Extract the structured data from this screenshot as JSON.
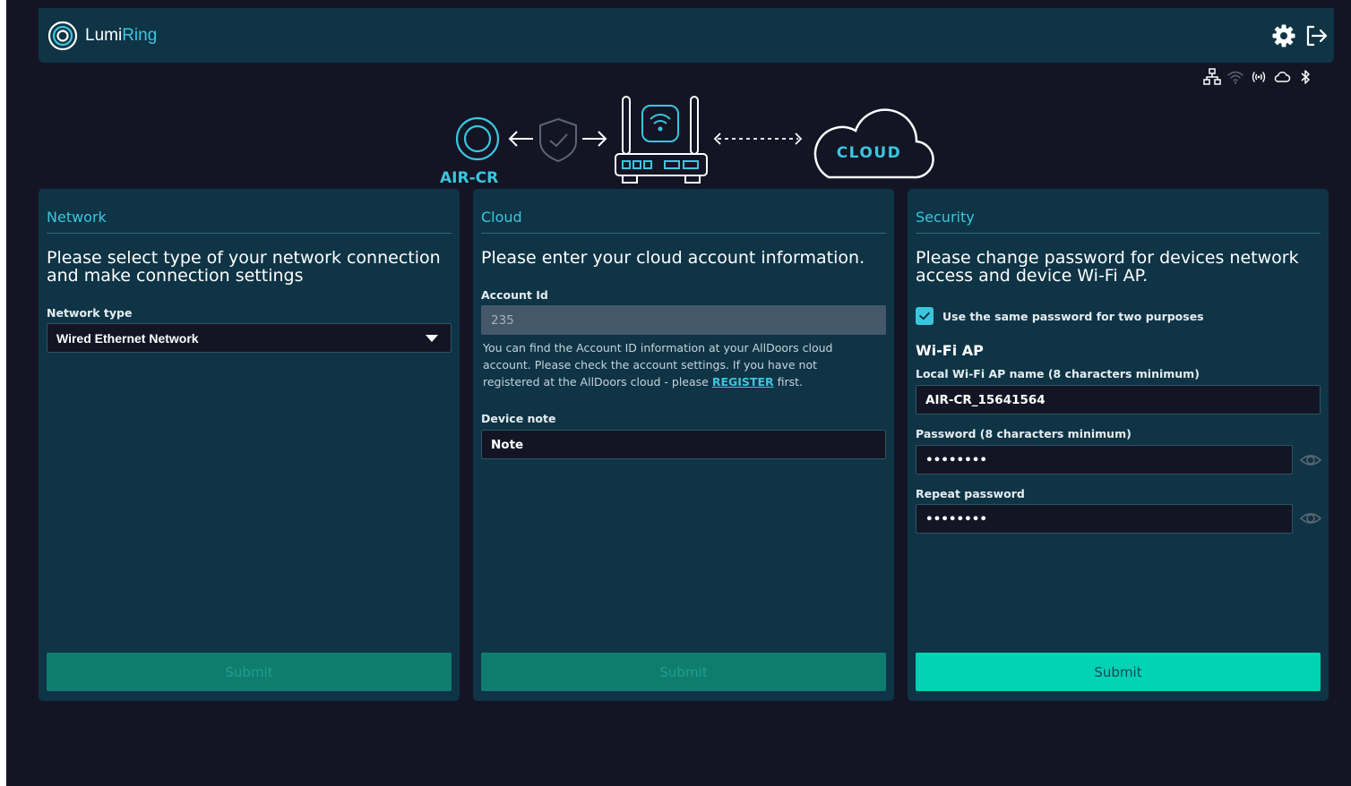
{
  "app": {
    "brand_part1": "Lumi",
    "brand_part2": "Ring"
  },
  "colors": {
    "accent": "#3bc6df",
    "panel": "#0e3445",
    "background": "#131525",
    "submit_active": "#00d3b4",
    "submit_disabled": "#107c6f"
  },
  "header": {
    "icons": [
      "settings-gear-icon",
      "logout-icon"
    ]
  },
  "status_icons": [
    "ethernet-icon",
    "wifi-icon",
    "radio-signal-icon",
    "cloud-icon",
    "bluetooth-icon"
  ],
  "diagram": {
    "device_label": "AIR-CR",
    "cloud_label": "CLOUD"
  },
  "network": {
    "title": "Network",
    "lead": "Please select type of your network connection and make connection settings",
    "type_label": "Network type",
    "type_value": "Wired Ethernet Network",
    "submit": "Submit"
  },
  "cloud": {
    "title": "Cloud",
    "lead": "Please enter your cloud account information.",
    "account_label": "Account Id",
    "account_value": "235",
    "help_text": "You can find the Account ID information at your AllDoors cloud account. Please check the account settings. If you have not registered at the AllDoors cloud - please",
    "help_link": "REGISTER",
    "help_tail": "first.",
    "note_label": "Device note",
    "note_value": "Note",
    "submit": "Submit"
  },
  "security": {
    "title": "Security",
    "lead": "Please change password for devices network access and device Wi-Fi AP.",
    "same_password_label": "Use the same password for two purposes",
    "same_password_checked": true,
    "wifi_heading": "Wi-Fi AP",
    "ap_name_label": "Local Wi-Fi AP name (8 characters minimum)",
    "ap_name_value": "AIR-CR_15641564",
    "password_label": "Password (8 characters minimum)",
    "password_value": "••••••••",
    "repeat_label": "Repeat password",
    "repeat_value": "••••••••",
    "submit": "Submit"
  }
}
